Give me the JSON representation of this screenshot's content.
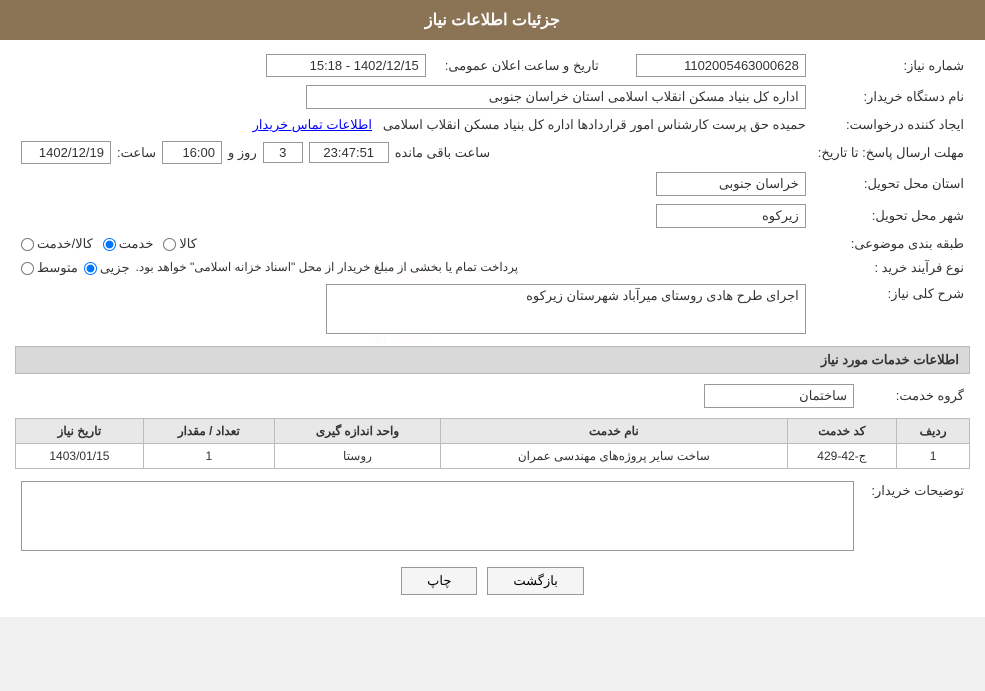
{
  "header": {
    "title": "جزئیات اطلاعات نیاز"
  },
  "fields": {
    "shomareNiaz_label": "شماره نیاز:",
    "shomareNiaz_value": "1102005463000628",
    "namDastgah_label": "نام دستگاه خریدار:",
    "namDastgah_value": "اداره کل بنیاد مسکن انقلاب اسلامی استان خراسان جنوبی",
    "ijadKonande_label": "ایجاد کننده درخواست:",
    "ijadKonande_value": "حمیده حق پرست کارشناس امور قراردادها اداره کل بنیاد مسکن انقلاب اسلامی",
    "ijadKonande_link": "اطلاعات تماس خریدار",
    "mohlat_label": "مهلت ارسال پاسخ: تا تاریخ:",
    "mohlat_date": "1402/12/19",
    "mohlat_time_label": "ساعت:",
    "mohlat_time": "16:00",
    "mohlat_roz_label": "روز و",
    "mohlat_roz": "3",
    "mohlat_countdown": "23:47:51",
    "mohlat_remaining_label": "ساعت باقی مانده",
    "tarikh_ailan_label": "تاریخ و ساعت اعلان عمومی:",
    "tarikh_ailan_value": "1402/12/15 - 15:18",
    "ostan_tahvil_label": "استان محل تحویل:",
    "ostan_tahvil_value": "خراسان جنوبی",
    "shahr_tahvil_label": "شهر محل تحویل:",
    "shahr_tahvil_value": "زیرکوه",
    "tabaqebandi_label": "طبقه بندی موضوعی:",
    "tabaqebandi_kala": "کالا",
    "tabaqebandi_khedmat": "خدمت",
    "tabaqebandi_kala_khedmat": "کالا/خدمت",
    "tabaqebandi_selected": "khedmat",
    "noeFarayand_label": "نوع فرآیند خرید :",
    "noeFarayand_jozvi": "جزیی",
    "noeFarayand_mota_label": "متوسط",
    "noeFarayand_description": "پرداخت تمام یا بخشی از مبلغ خریدار از محل \"اسناد خزانه اسلامی\" خواهد بود.",
    "sharh_niaz_label": "شرح کلی نیاز:",
    "sharh_niaz_value": "اجرای طرح هادی روستای میرآباد شهرستان زیرکوه",
    "services_section_title": "اطلاعات خدمات مورد نیاز",
    "gorohe_khedmat_label": "گروه خدمت:",
    "gorohe_khedmat_value": "ساختمان",
    "table_headers": {
      "radif": "ردیف",
      "kod_khedmat": "کد خدمت",
      "nam_khedmat": "نام خدمت",
      "vahed_andazegiri": "واحد اندازه گیری",
      "tedad_miqdar": "تعداد / مقدار",
      "tarikh_niaz": "تاریخ نیاز"
    },
    "table_rows": [
      {
        "radif": "1",
        "kod_khedmat": "ج-42-429",
        "nam_khedmat": "ساخت سایر پروژه‌های مهندسی عمران",
        "vahed_andazegiri": "روستا",
        "tedad_miqdar": "1",
        "tarikh_niaz": "1403/01/15"
      }
    ],
    "tozihat_label": "توضیحات خریدار:",
    "tozihat_value": ""
  },
  "buttons": {
    "chap_label": "چاپ",
    "bazgasht_label": "بازگشت"
  }
}
